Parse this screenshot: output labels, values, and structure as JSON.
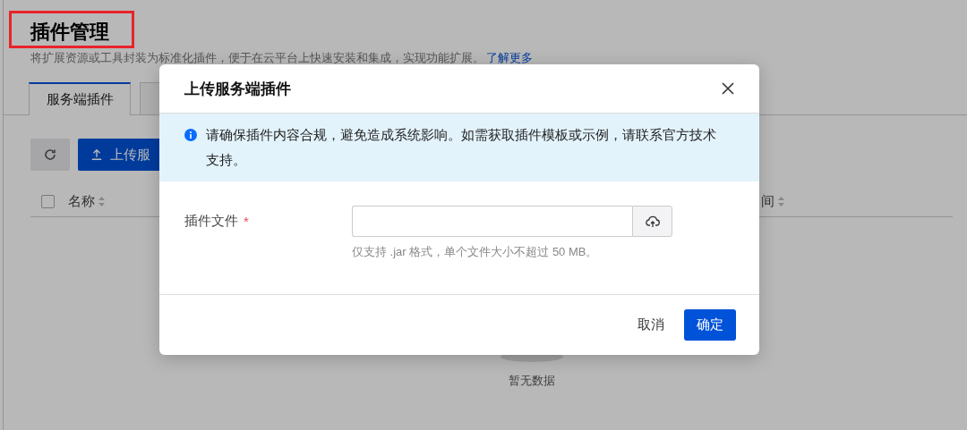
{
  "page": {
    "title": "插件管理",
    "description": "将扩展资源或工具封装为标准化插件，便于在云平台上快速安装和集成，实现功能扩展。",
    "learn_more_link": "了解更多"
  },
  "tabs": [
    {
      "label": "服务端插件",
      "selected": true
    },
    {
      "selected": false
    }
  ],
  "toolbar": {
    "upload_button": "上传服"
  },
  "table": {
    "select_all_checked": false,
    "columns": [
      {
        "label": "名称",
        "sortable": true
      },
      {
        "label": "间",
        "sortable": true
      }
    ],
    "empty_text": "暂无数据"
  },
  "dialog": {
    "title": "上传服务端插件",
    "notice": "请确保插件内容合规，避免造成系统影响。如需获取插件模板或示例，请联系官方技术支持。",
    "fields": [
      {
        "label": "插件文件",
        "required_mark": "*",
        "hint": "仅支持 .jar 格式，单个文件大小不超过 50 MB。"
      }
    ],
    "buttons": [
      {
        "label": "取消",
        "kind": "text"
      },
      {
        "label": "确定",
        "kind": "primary"
      }
    ]
  }
}
